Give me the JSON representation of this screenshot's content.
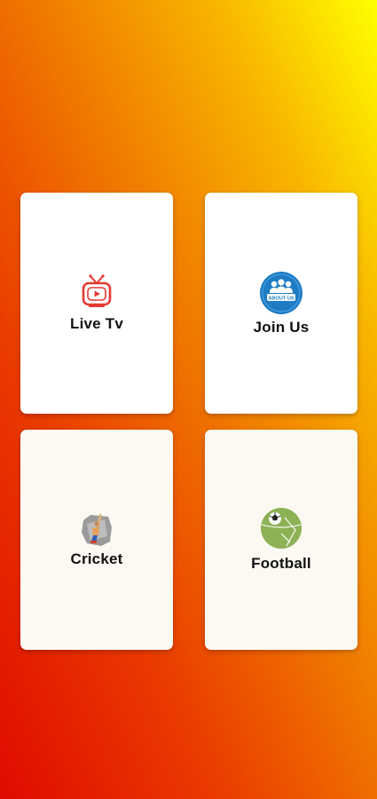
{
  "menu": {
    "cards": [
      {
        "label": "Live Tv",
        "icon": "tv-icon"
      },
      {
        "label": "Join Us",
        "icon": "about-us-icon",
        "icon_text": "ABOUT US"
      },
      {
        "label": "Cricket",
        "icon": "cricket-icon"
      },
      {
        "label": "Football",
        "icon": "football-icon"
      }
    ]
  },
  "colors": {
    "gradient_bottom_left": "#e00a00",
    "gradient_top_right": "#ffff00",
    "card_white": "#ffffff",
    "card_cream": "#fcf9f3",
    "tv_red": "#e53935",
    "about_blue": "#1f7cc4",
    "football_green": "#8db255"
  }
}
